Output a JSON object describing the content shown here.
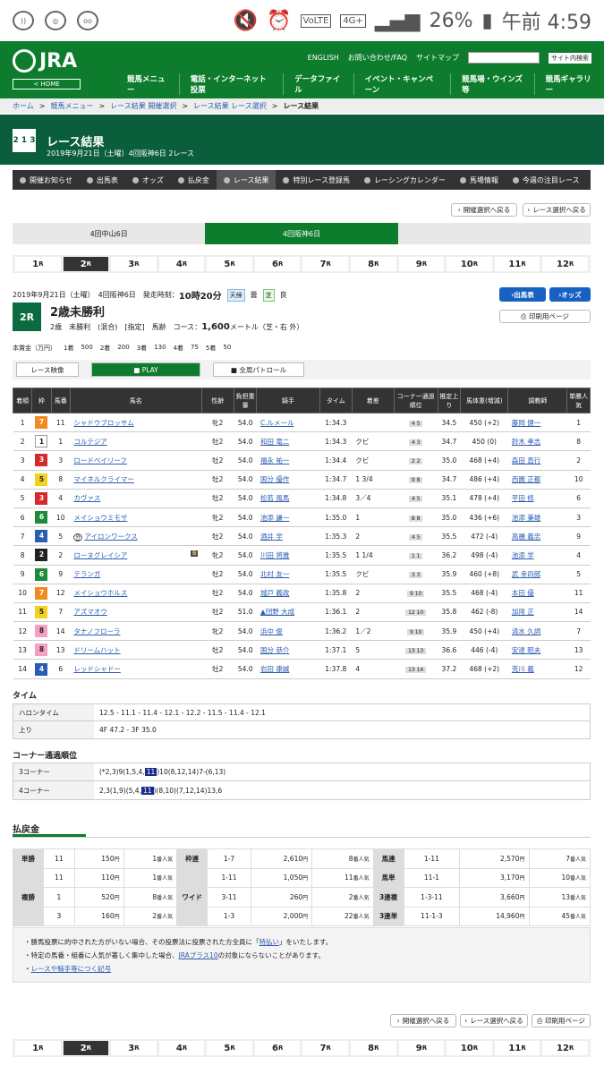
{
  "status": {
    "battery": "26%",
    "time": "午前 4:59",
    "net": "4G+",
    "volte": "VoLTE"
  },
  "header": {
    "logo": "JRA",
    "home": "< HOME",
    "links": [
      "ENGLISH",
      "お問い合わせ/FAQ",
      "サイトマップ"
    ],
    "site_search": "サイト内検索",
    "nav": [
      "競馬メニュー",
      "電話・インターネット投票",
      "データファイル",
      "イベント・キャンペーン",
      "競馬場・ウインズ等",
      "競馬ギャラリー"
    ]
  },
  "breadcrumb": [
    "ホーム",
    "競馬メニュー",
    "レース結果 開催選択",
    "レース結果 レース選択",
    "レース結果"
  ],
  "banner": {
    "title": "レース結果",
    "subtitle": "2019年9月21日（土曜）4回阪神6日 2レース",
    "icon": "2 1 3"
  },
  "subnav": [
    "開催お知らせ",
    "出馬表",
    "オッズ",
    "払戻金",
    "レース結果",
    "特別レース登録馬",
    "レーシングカレンダー",
    "馬場情報",
    "今週の注目レース"
  ],
  "buttons": {
    "meet_back": "開催選択へ戻る",
    "race_back": "レース選択へ戻る",
    "print": "印刷用ページ",
    "entry": "出馬表",
    "odds": "オッズ"
  },
  "meets": [
    "4回中山6日",
    "4回阪神6日"
  ],
  "races": [
    "1",
    "2",
    "3",
    "4",
    "5",
    "6",
    "7",
    "8",
    "9",
    "10",
    "11",
    "12"
  ],
  "race_suffix": "R",
  "race": {
    "date_line": "2019年9月21日（土曜）　4回阪神6日　発走時刻：",
    "post_time": "10時20分",
    "weather_label": "天候",
    "weather": "曇",
    "track_label": "芝",
    "track": "良",
    "num": "2R",
    "name": "2歳未勝利",
    "conditions": "2歳　未勝利　(混合)　[指定]　馬齢",
    "course": "コース：",
    "distance": "1,600",
    "course_unit": "メートル（芝・右 外）",
    "prize_label": "本賞金（万円）",
    "prizes": [
      "1着",
      "500",
      "2着",
      "200",
      "3着",
      "130",
      "4着",
      "75",
      "5着",
      "50"
    ]
  },
  "video": {
    "video": "レース映像",
    "play": "PLAY",
    "patrol": "全周パトロール"
  },
  "table_headers": [
    "着順",
    "枠",
    "馬番",
    "馬名",
    "性齢",
    "負担重量",
    "騎手",
    "タイム",
    "着差",
    "コーナー通過順位",
    "推定上り",
    "馬体重(増減)",
    "調教師",
    "単勝人気"
  ],
  "results": [
    [
      "1",
      "7",
      "11",
      "シャドウブロッサム",
      "牝2",
      "54.0",
      "C.ルメール",
      "1:34.3",
      "",
      "4 5",
      "34.5",
      "450 (+2)",
      "藤岡 健一",
      "1"
    ],
    [
      "2",
      "1",
      "1",
      "コルテジア",
      "牡2",
      "54.0",
      "和田 竜二",
      "1:34.3",
      "クビ",
      "4 3",
      "34.7",
      "450 (0)",
      "鈴木 孝志",
      "8"
    ],
    [
      "3",
      "3",
      "3",
      "ロードベイリーフ",
      "牡2",
      "54.0",
      "福永 祐一",
      "1:34.4",
      "クビ",
      "2 2",
      "35.0",
      "468 (+4)",
      "森田 直行",
      "2"
    ],
    [
      "4",
      "5",
      "8",
      "マイネルクライマー",
      "牡2",
      "54.0",
      "国分 優作",
      "1:34.7",
      "1 3/4",
      "9 8",
      "34.7",
      "486 (+4)",
      "西園 正都",
      "10"
    ],
    [
      "5",
      "3",
      "4",
      "カヴァス",
      "牡2",
      "54.0",
      "松若 風馬",
      "1:34.8",
      "3／4",
      "4 5",
      "35.1",
      "478 (+4)",
      "平田 修",
      "6"
    ],
    [
      "6",
      "6",
      "10",
      "メイショウミモザ",
      "牝2",
      "54.0",
      "池添 謙一",
      "1:35.0",
      "1",
      "8 8",
      "35.0",
      "436 (+6)",
      "池添 兼雄",
      "3"
    ],
    [
      "7",
      "4",
      "5",
      "アイロンワークス",
      "牡2",
      "54.0",
      "酒井 学",
      "1:35.3",
      "2",
      "4 5",
      "35.5",
      "472 (-4)",
      "高橋 義忠",
      "9"
    ],
    [
      "8",
      "2",
      "2",
      "ローヌグレイシア",
      "牝2",
      "54.0",
      "川田 将雅",
      "1:35.5",
      "1 1/4",
      "1 1",
      "36.2",
      "498 (-4)",
      "池添 学",
      "4"
    ],
    [
      "9",
      "6",
      "9",
      "テランガ",
      "牡2",
      "54.0",
      "北村 友一",
      "1:35.5",
      "クビ",
      "3 3",
      "35.9",
      "460 (+8)",
      "武 幸四郎",
      "5"
    ],
    [
      "10",
      "7",
      "12",
      "メイショウホルス",
      "牡2",
      "54.0",
      "城戸 義政",
      "1:35.8",
      "2",
      "9 10",
      "35.5",
      "468 (-4)",
      "本田 優",
      "11"
    ],
    [
      "11",
      "5",
      "7",
      "アズマオウ",
      "牡2",
      "51.0",
      "▲団野 大成",
      "1:36.1",
      "2",
      "12 10",
      "35.8",
      "462 (-8)",
      "加用 正",
      "14"
    ],
    [
      "12",
      "8",
      "14",
      "タナノフローラ",
      "牝2",
      "54.0",
      "浜中 俊",
      "1:36.2",
      "1／2",
      "9 10",
      "35.9",
      "450 (+4)",
      "清水 久詞",
      "7"
    ],
    [
      "13",
      "8",
      "13",
      "ドリームハット",
      "牡2",
      "54.0",
      "国分 恭介",
      "1:37.1",
      "5",
      "13 13",
      "36.6",
      "446 (-4)",
      "安達 昭夫",
      "13"
    ],
    [
      "14",
      "4",
      "6",
      "レッドシャドー",
      "牡2",
      "54.0",
      "岩田 康誠",
      "1:37.8",
      "4",
      "13 14",
      "37.2",
      "468 (+2)",
      "荒川 義",
      "12"
    ]
  ],
  "waku_colors": {
    "1": "#ffffff",
    "2": "#222222",
    "3": "#d62a2a",
    "4": "#2a5db0",
    "5": "#f2d21f",
    "6": "#1f8a3a",
    "7": "#f28a1f",
    "8": "#f5a0c0"
  },
  "marks": {
    "7": "外",
    "8": "B"
  },
  "time_section": {
    "title": "タイム",
    "halon_label": "ハロンタイム",
    "halon": "12.5 - 11.1 - 11.4 - 12.1 - 12.2 - 11.5 - 11.4 - 12.1",
    "agari_label": "上り",
    "agari": "4F 47.2 - 3F 35.0"
  },
  "corner_section": {
    "title": "コーナー通過順位",
    "c3_label": "3コーナー",
    "c3_pre": "(*2,3)9(1,5,4,",
    "c3_post": ")10(8,12,14)7-(6,13)",
    "c4_label": "4コーナー",
    "c4_pre": "2,3(1,9)(5,4,",
    "c4_post": ")(8,10)(7,12,14)13,6",
    "hl": "11"
  },
  "payout": {
    "title": "払戻金",
    "yen": "円",
    "ninki": "番人気",
    "tansho": {
      "label": "単勝",
      "rows": [
        [
          "11",
          "150",
          "1"
        ]
      ]
    },
    "fukusho": {
      "label": "複勝",
      "rows": [
        [
          "11",
          "110",
          "1"
        ],
        [
          "1",
          "520",
          "8"
        ],
        [
          "3",
          "160",
          "2"
        ]
      ]
    },
    "wakuren": {
      "label": "枠連",
      "rows": [
        [
          "1-7",
          "2,610",
          "8"
        ]
      ]
    },
    "wide": {
      "label": "ワイド",
      "rows": [
        [
          "1-11",
          "1,050",
          "11"
        ],
        [
          "3-11",
          "260",
          "2"
        ],
        [
          "1-3",
          "2,000",
          "22"
        ]
      ]
    },
    "umaren": {
      "label": "馬連",
      "rows": [
        [
          "1-11",
          "2,570",
          "7"
        ]
      ]
    },
    "umatan": {
      "label": "馬単",
      "rows": [
        [
          "11-1",
          "3,170",
          "10"
        ]
      ]
    },
    "trio": {
      "label": "3連複",
      "rows": [
        [
          "1-3-11",
          "3,660",
          "13"
        ]
      ]
    },
    "trifecta": {
      "label": "3連単",
      "rows": [
        [
          "11-1-3",
          "14,960",
          "45"
        ]
      ]
    }
  },
  "notes": {
    "n1a": "勝馬投票に的中された方がいない場合、その投票法に投票された方全員に「",
    "n1b": "特払い",
    "n1c": "」をいたします。",
    "n2a": "特定の馬番・組番に人気が著しく集中した場合、",
    "n2b": "JRAプラス10",
    "n2c": "の対象にならないことがあります。",
    "n3": "レースや騎手等につく記号"
  }
}
